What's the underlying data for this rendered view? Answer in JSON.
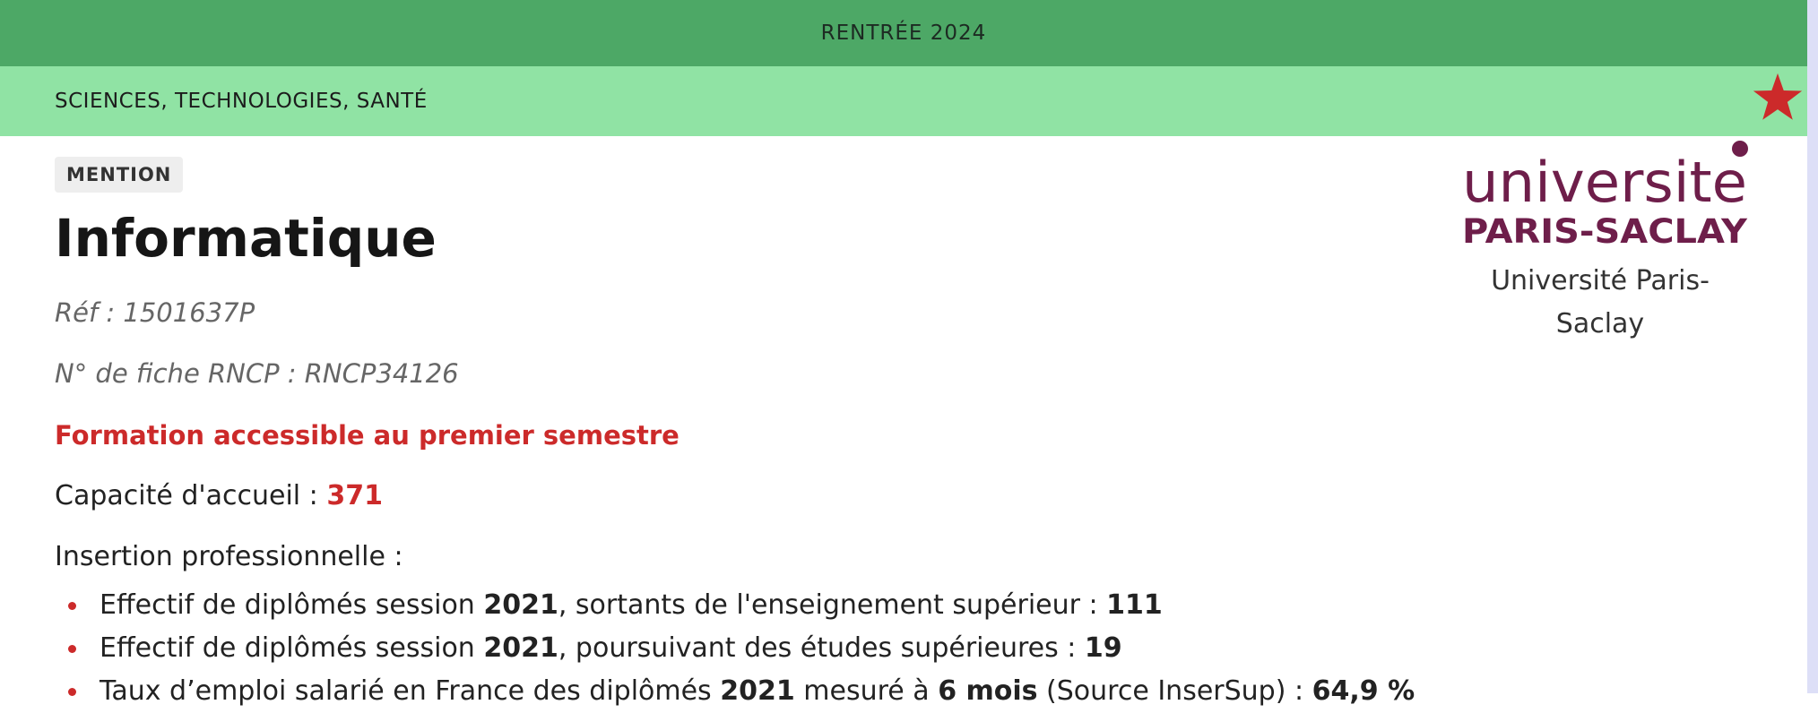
{
  "header": {
    "rentree": "RENTRÉE 2024",
    "domain": "SCIENCES, TECHNOLOGIES, SANTÉ"
  },
  "colors": {
    "band_top": "#4da866",
    "band_sub": "#90e3a4",
    "accent_red": "#cc2a2a",
    "logo_purple": "#6e1e4a"
  },
  "icons": {
    "favorite": "star-icon"
  },
  "formation": {
    "badge": "MENTION",
    "title": "Informatique",
    "ref": "Réf : 1501637P",
    "rncp": "N° de fiche RNCP : RNCP34126",
    "semester_notice": "Formation accessible au premier semestre",
    "capacity_label": "Capacité d'accueil : ",
    "capacity_value": "371",
    "insertion_label": "Insertion professionnelle :"
  },
  "insertion_stats": [
    {
      "t1": "Effectif de diplômés session ",
      "b1": "2021",
      "t2": ", sortants de l'enseignement supérieur : ",
      "b2": "111"
    },
    {
      "t1": "Effectif de diplômés session ",
      "b1": "2021",
      "t2": ", poursuivant des études supérieures : ",
      "b2": "19"
    },
    {
      "t1": "Taux d’emploi salarié en France des diplômés ",
      "b1": "2021",
      "t2": " mesuré à ",
      "b2": "6 mois",
      "t3": " (Source InserSup) : ",
      "b3": "64,9 %"
    }
  ],
  "university": {
    "logo_line1": "universite",
    "logo_line2": "PARIS-SACLAY",
    "name_line1": "Université Paris-",
    "name_line2": "Saclay"
  }
}
